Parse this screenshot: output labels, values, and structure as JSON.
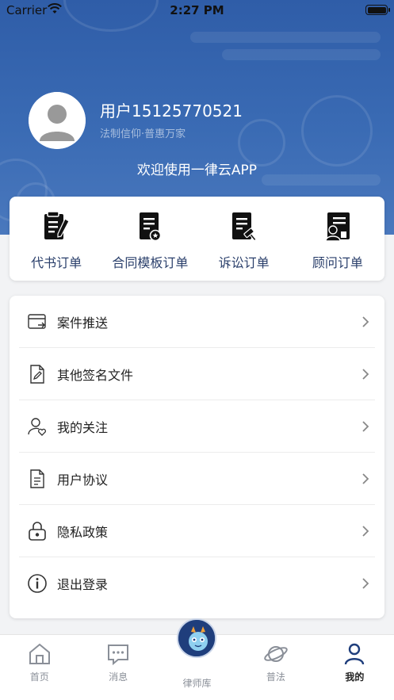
{
  "status_bar": {
    "carrier": "Carrier",
    "time": "2:27 PM"
  },
  "profile": {
    "username": "用户15125770521",
    "slogan": "法制信仰·普惠万家",
    "welcome": "欢迎使用一律云APP"
  },
  "orders": [
    {
      "label": "代书订单",
      "icon": "document-pen-icon"
    },
    {
      "label": "合同模板订单",
      "icon": "document-seal-icon"
    },
    {
      "label": "诉讼订单",
      "icon": "document-gavel-icon"
    },
    {
      "label": "顾问订单",
      "icon": "advisor-certificate-icon"
    }
  ],
  "menu": [
    {
      "label": "案件推送",
      "icon": "card-push-icon"
    },
    {
      "label": "其他签名文件",
      "icon": "signed-file-icon"
    },
    {
      "label": "我的关注",
      "icon": "user-heart-icon"
    },
    {
      "label": "用户协议",
      "icon": "agreement-doc-icon"
    },
    {
      "label": "隐私政策",
      "icon": "lock-icon"
    },
    {
      "label": "退出登录",
      "icon": "info-exit-icon"
    }
  ],
  "tabbar": [
    {
      "label": "首页",
      "icon": "home-icon",
      "active": false
    },
    {
      "label": "消息",
      "icon": "message-icon",
      "active": false
    },
    {
      "label": "律师库",
      "icon": "mascot-logo-icon",
      "active": false
    },
    {
      "label": "普法",
      "icon": "planet-icon",
      "active": false
    },
    {
      "label": "我的",
      "icon": "user-icon",
      "active": true
    }
  ],
  "colors": {
    "header_blue": "#3a6bb4",
    "order_label": "#2a3f6b",
    "tab_inactive": "#8a8f98",
    "tab_active_icon": "#1f3e7c"
  }
}
